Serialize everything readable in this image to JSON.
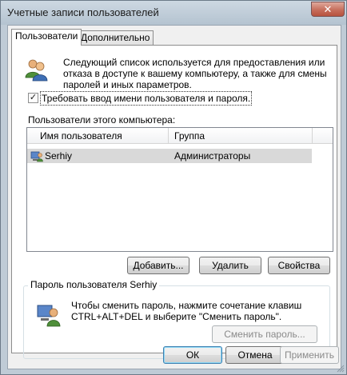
{
  "window": {
    "title": "Учетные записи пользователей",
    "close_label": "✕"
  },
  "tabs": [
    {
      "label": "Пользователи",
      "active": true
    },
    {
      "label": "Дополнительно",
      "active": false
    }
  ],
  "users_tab": {
    "description": "Следующий список используется для предоставления или отказа в доступе к вашему компьютеру, а также для смены паролей и иных параметров.",
    "require_login_checkbox": {
      "label": "Требовать ввод имени пользователя и пароля.",
      "checked": true,
      "check_mark": "✓"
    },
    "users_list_label": "Пользователи этого компьютера:",
    "columns": [
      "Имя пользователя",
      "Группа"
    ],
    "rows": [
      {
        "user": "Serhiy",
        "group": "Администраторы",
        "selected": true
      }
    ],
    "buttons": {
      "add": "Добавить...",
      "remove": "Удалить",
      "properties": "Свойства"
    },
    "password_group": {
      "title": "Пароль пользователя Serhiy",
      "text": "Чтобы сменить пароль, нажмите сочетание клавиш CTRL+ALT+DEL и выберите \"Сменить пароль\".",
      "change_password_button": "Сменить пароль..."
    }
  },
  "dialog_buttons": {
    "ok": "ОК",
    "cancel": "Отмена",
    "apply": "Применить"
  },
  "colors": {
    "window_frame": "#bfcbd6",
    "selection": "#d9d9d9",
    "default_button_border": "#3c7fb1"
  }
}
